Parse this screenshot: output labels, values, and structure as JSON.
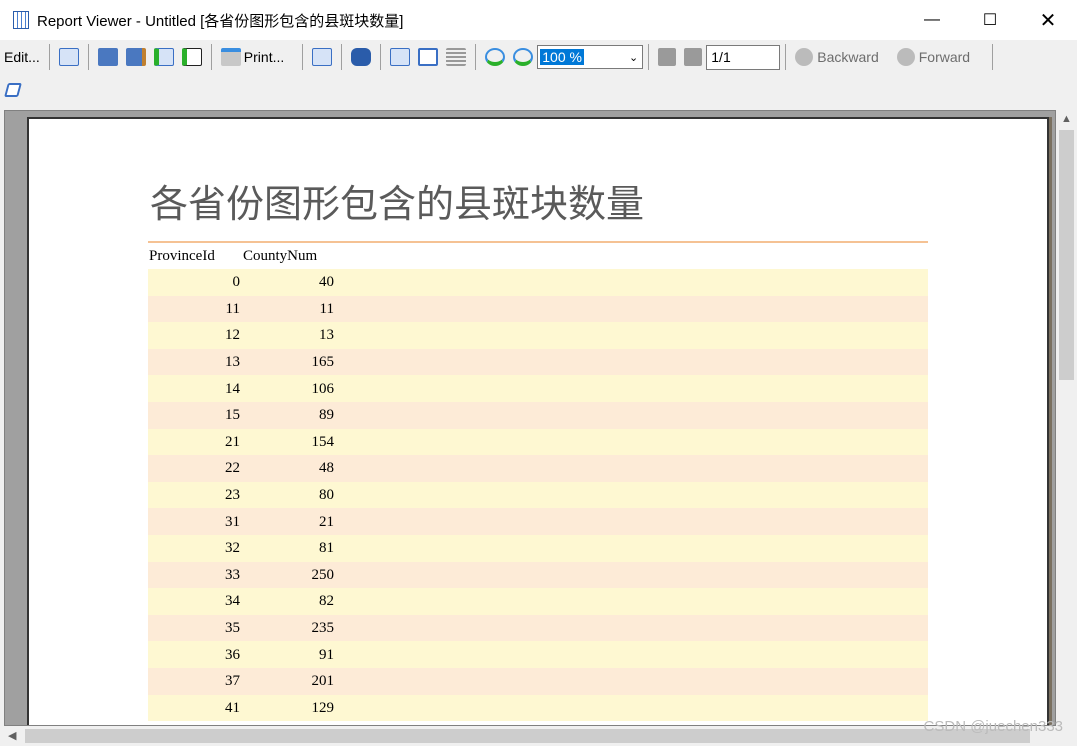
{
  "window": {
    "title": "Report Viewer - Untitled [各省份图形包含的县斑块数量]"
  },
  "toolbar": {
    "edit": "Edit...",
    "print": "Print...",
    "zoom": "100 %",
    "page": "1/1",
    "backward": "Backward",
    "forward": "Forward"
  },
  "report": {
    "title": "各省份图形包含的县斑块数量",
    "columns": [
      "ProvinceId",
      "CountyNum"
    ],
    "rows": [
      [
        "0",
        "40"
      ],
      [
        "11",
        "11"
      ],
      [
        "12",
        "13"
      ],
      [
        "13",
        "165"
      ],
      [
        "14",
        "106"
      ],
      [
        "15",
        "89"
      ],
      [
        "21",
        "154"
      ],
      [
        "22",
        "48"
      ],
      [
        "23",
        "80"
      ],
      [
        "31",
        "21"
      ],
      [
        "32",
        "81"
      ],
      [
        "33",
        "250"
      ],
      [
        "34",
        "82"
      ],
      [
        "35",
        "235"
      ],
      [
        "36",
        "91"
      ],
      [
        "37",
        "201"
      ],
      [
        "41",
        "129"
      ]
    ]
  },
  "watermark": "CSDN @juechen333"
}
